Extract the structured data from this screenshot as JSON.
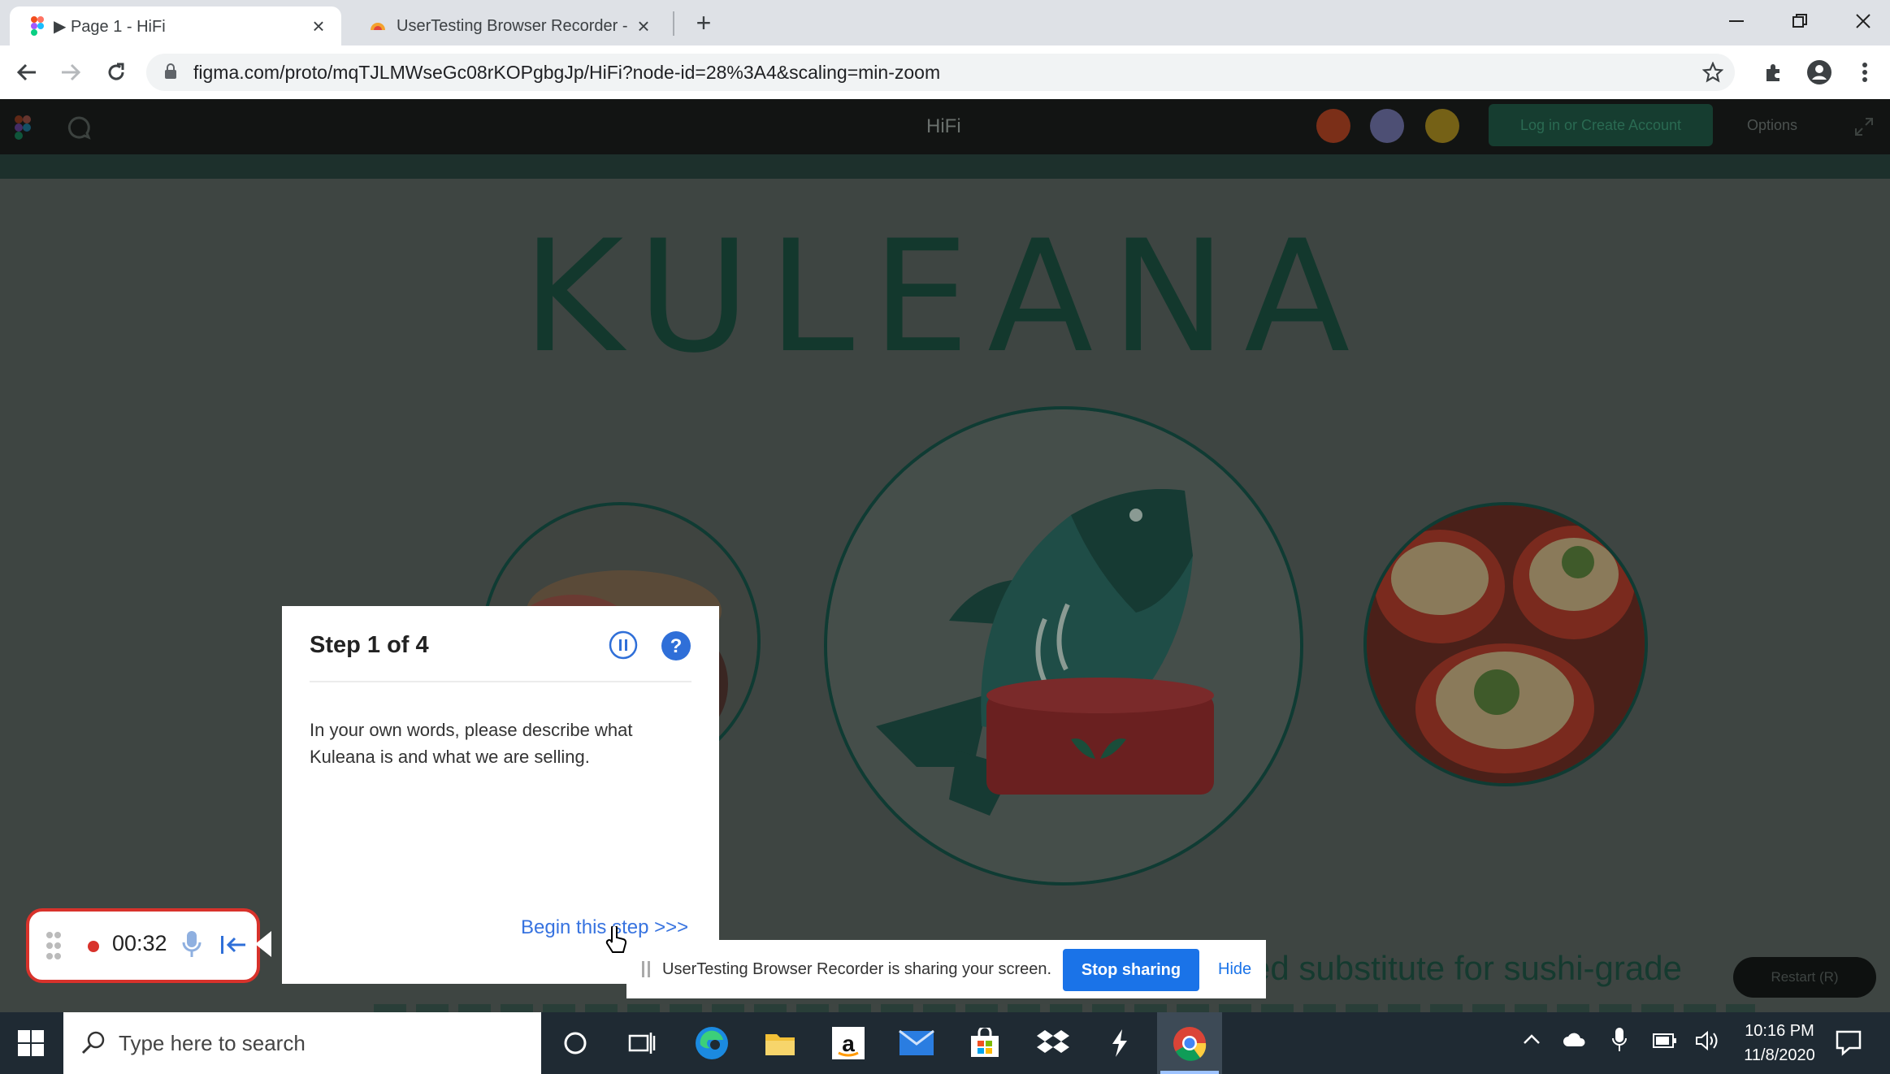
{
  "browser": {
    "tabs": [
      {
        "title": "▶ Page 1 - HiFi",
        "active": true
      },
      {
        "title": "UserTesting Browser Recorder - C",
        "active": false
      }
    ],
    "url": "figma.com/proto/mqTJLMWseGc08rKOPgbgJp/HiFi?node-id=28%3A4&scaling=min-zoom",
    "window_controls": [
      "minimize",
      "restore",
      "close"
    ]
  },
  "figma": {
    "prototype_title": "HiFi",
    "login_button": "Log in or Create Account",
    "options_label": "Options",
    "restart_label": "Restart (R)"
  },
  "page": {
    "logo_text": "KULEANA",
    "main_text_fragment": "ed substitute for sushi-grade"
  },
  "step_dialog": {
    "title": "Step 1 of 4",
    "body": "In your own words, please describe what Kuleana is and what we are selling.",
    "begin_label": "Begin this step >>>"
  },
  "recorder": {
    "time": "00:32"
  },
  "share_bar": {
    "message": "UserTesting Browser Recorder is sharing your screen.",
    "stop_label": "Stop sharing",
    "hide_label": "Hide"
  },
  "taskbar": {
    "search_placeholder": "Type here to search",
    "time": "10:16 PM",
    "date": "11/8/2020"
  },
  "colors": {
    "accent_blue": "#1a73e8",
    "recorder_red": "#d8322b",
    "brand_dark_green": "#13382d"
  }
}
